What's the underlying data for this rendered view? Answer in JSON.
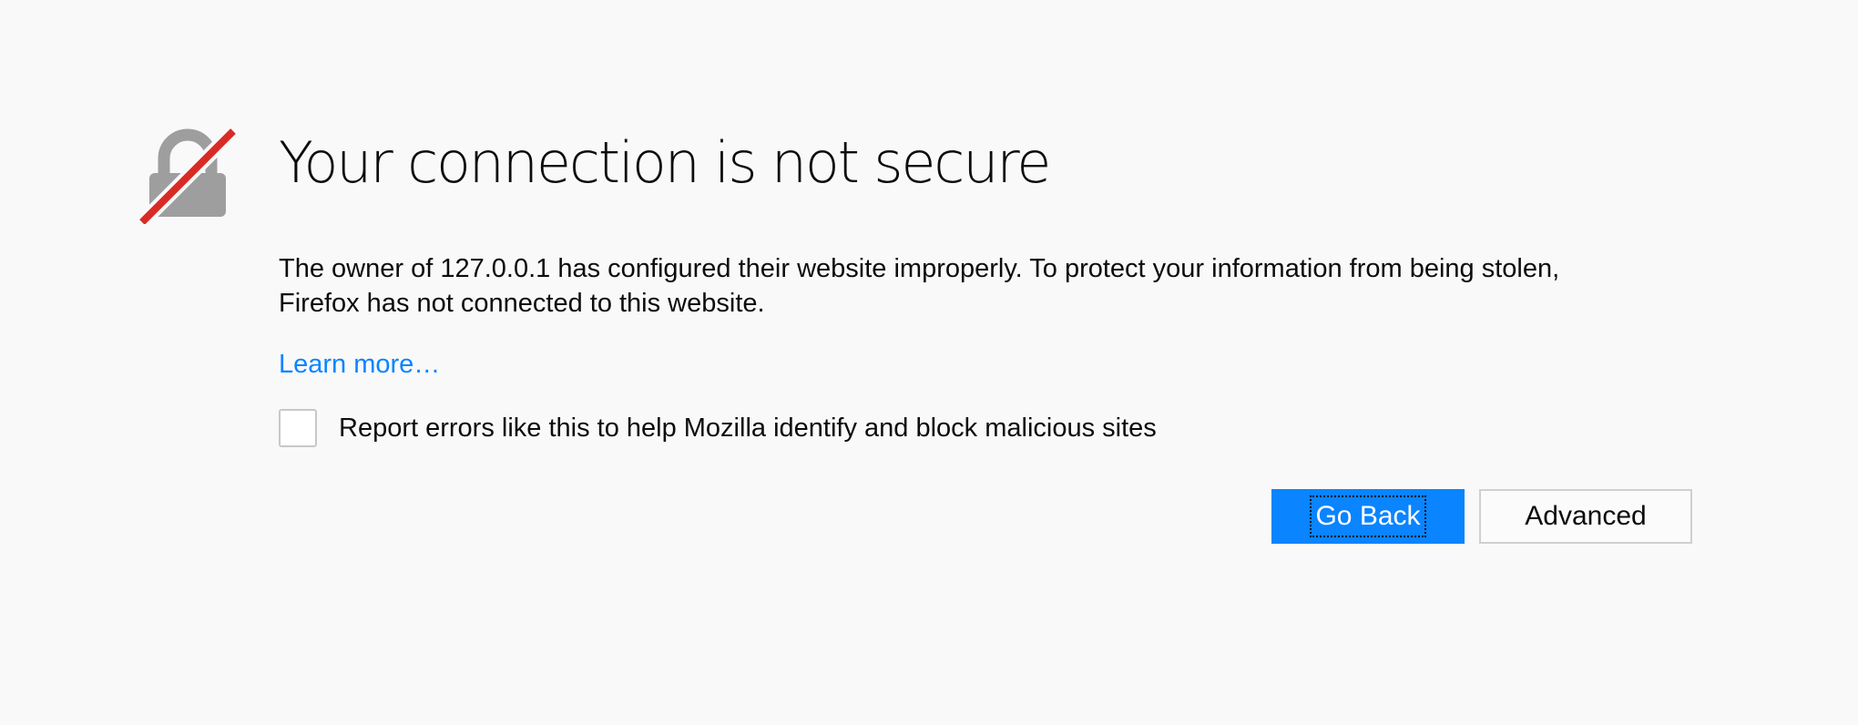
{
  "error_page": {
    "icon": "insecure-lock-icon",
    "title": "Your connection is not secure",
    "description": {
      "line1": "The owner of 127.0.0.1 has configured their website improperly. To protect your information from being stolen,",
      "line2": "Firefox has not connected to this website."
    },
    "learn_more": "Learn more…",
    "report_checkbox": {
      "label": "Report errors like this to help Mozilla identify and block malicious sites",
      "checked": false
    },
    "buttons": {
      "go_back": "Go Back",
      "advanced": "Advanced"
    }
  },
  "colors": {
    "background": "#f9f9fa",
    "primary_button": "#0a84ff",
    "link": "#0a84ff",
    "lock_gray": "#9e9e9e",
    "slash_red": "#d92b24"
  }
}
